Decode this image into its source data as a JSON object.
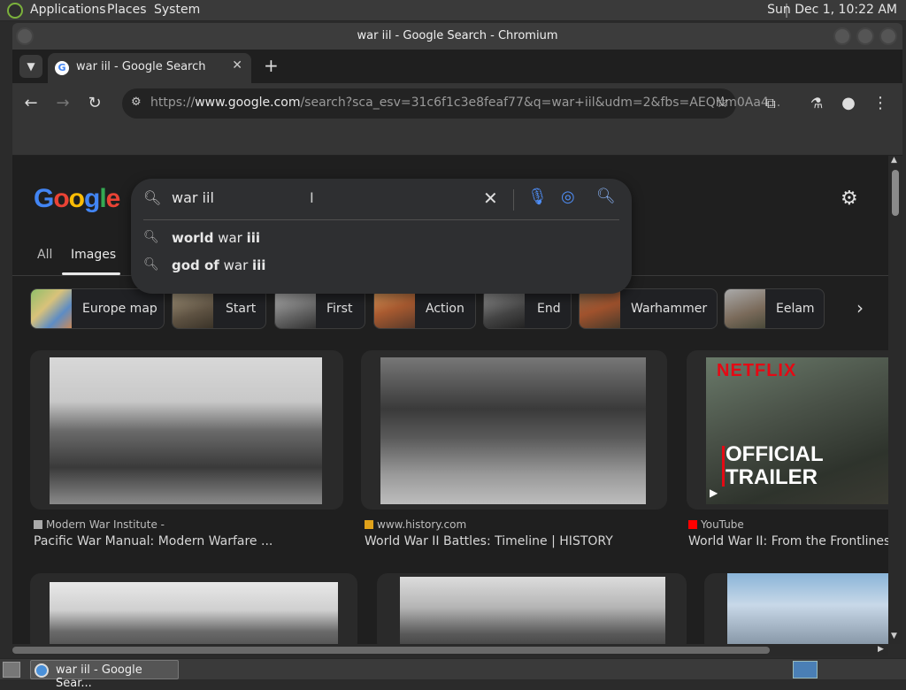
{
  "panel": {
    "menus": [
      "Applications",
      "Places",
      "System"
    ],
    "clock": "Sun Dec  1, 10:22 AM"
  },
  "window": {
    "title": "war iil - Google Search - Chromium"
  },
  "tab": {
    "title": "war iil - Google Search"
  },
  "toolbar": {
    "url_prefix": "https://",
    "url_host": "www.google.com",
    "url_rest": "/search?sca_esv=31c6f1c3e8feaf77&q=war+iil&udm=2&fbs=AEQNm0Aa4..."
  },
  "google": {
    "logo_letters": [
      "G",
      "o",
      "o",
      "g",
      "l",
      "e"
    ],
    "logo_colors": [
      "#4285f4",
      "#ea4335",
      "#fbbc05",
      "#4285f4",
      "#34a853",
      "#ea4335"
    ]
  },
  "search": {
    "query": "war iil",
    "suggestions": [
      {
        "bold_a": "world",
        "normal": " war ",
        "bold_b": "iii"
      },
      {
        "bold_a": "god of",
        "normal": " war ",
        "bold_b": "iii"
      }
    ]
  },
  "nav": {
    "all": "All",
    "images": "Images"
  },
  "chips": [
    "Europe map",
    "Start",
    "First",
    "Action",
    "End",
    "Warhammer",
    "Eelam"
  ],
  "results": [
    {
      "source": "Modern War Institute -",
      "title": "Pacific War Manual: Modern Warfare ...",
      "fav_color": "#aaaaaa"
    },
    {
      "source": "www.history.com",
      "title": "World War II Battles: Timeline | HISTORY",
      "fav_color": "#e0a21a"
    },
    {
      "source": "YouTube",
      "title": "World War II: From the Frontlines ...",
      "fav_color": "#ff0000",
      "overlay_brand": "NETFLIX",
      "overlay_line1": "OFFICIAL",
      "overlay_line2": "TRAILER"
    }
  ],
  "taskbar": {
    "task_label": "war iil - Google Sear..."
  }
}
